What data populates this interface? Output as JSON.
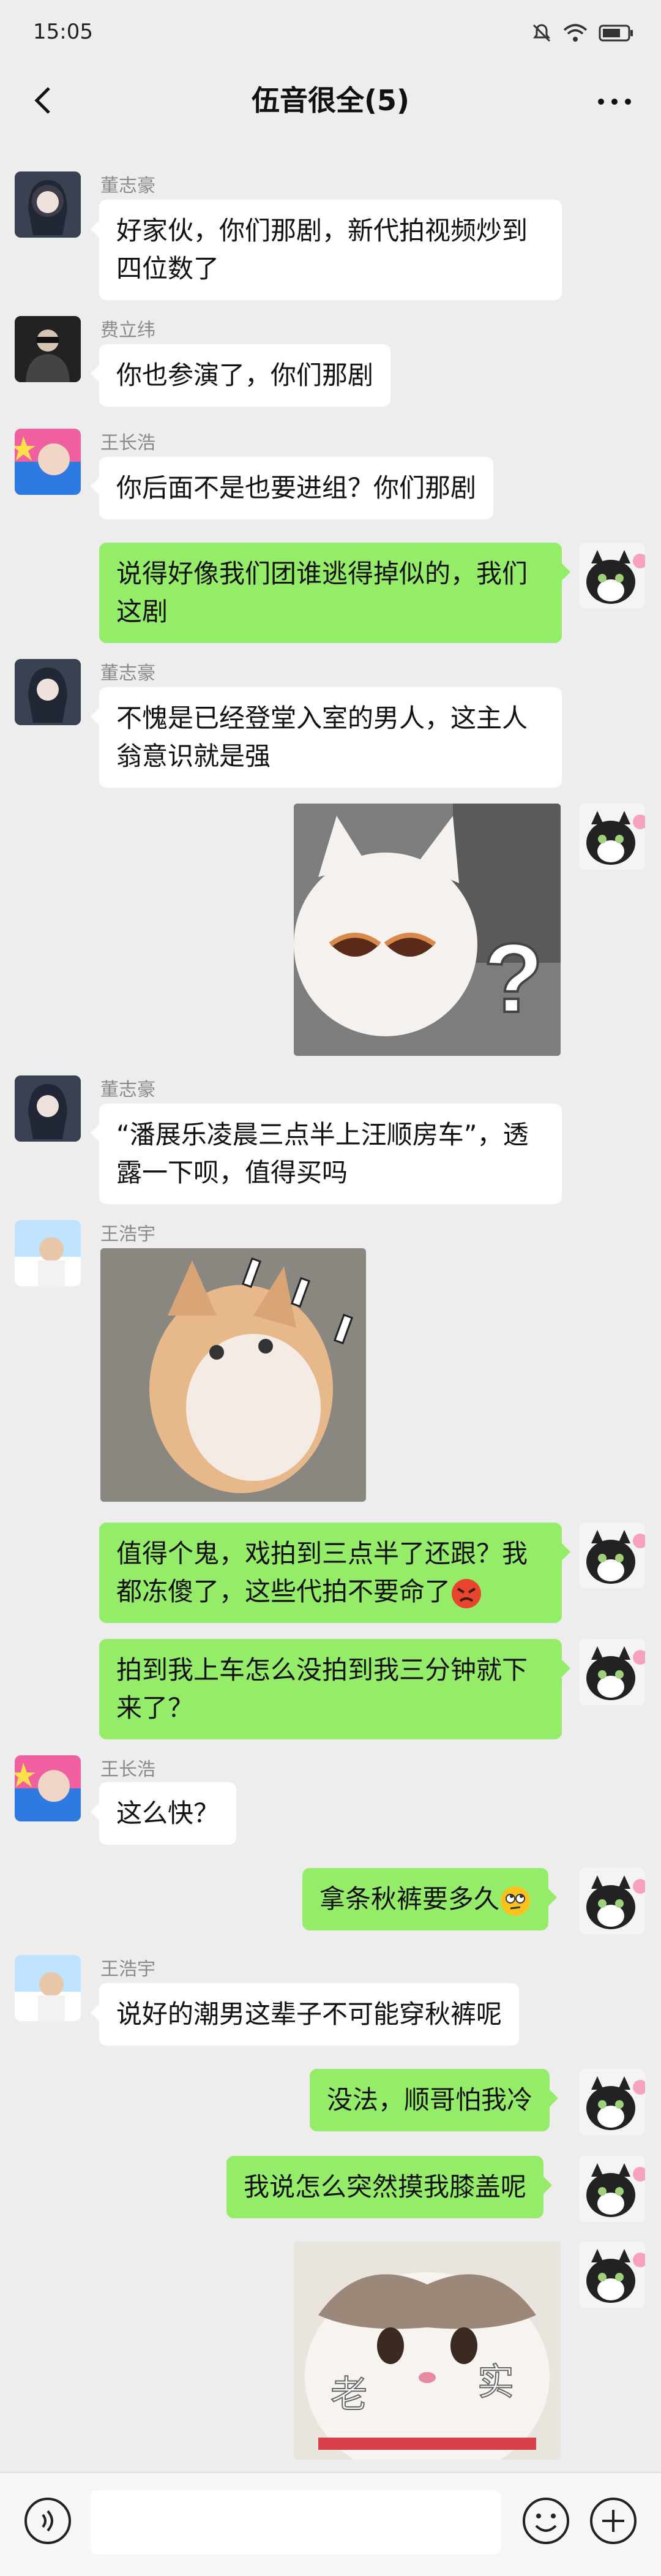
{
  "status": {
    "time": "15:05"
  },
  "header": {
    "title": "伍音很全(5)"
  },
  "messages": [
    {
      "sender": "董志豪",
      "text": "好家伙，你们那剧，新代拍视频炒到四位数了"
    },
    {
      "sender": "费立纬",
      "text": "你也参演了，你们那剧"
    },
    {
      "sender": "王长浩",
      "text": "你后面不是也要进组？你们那剧"
    },
    {
      "sender": "me",
      "text": "说得好像我们团谁逃得掉似的，我们这剧"
    },
    {
      "sender": "董志豪",
      "text": "不愧是已经登堂入室的男人，这主人翁意识就是强"
    },
    {
      "sender": "me",
      "sticker": "cat-sunglasses-question"
    },
    {
      "sender": "董志豪",
      "text": "“潘展乐凌晨三点半上汪顺房车”，透露一下呗，值得买吗"
    },
    {
      "sender": "王浩宇",
      "sticker": "kitten-shocked"
    },
    {
      "sender": "me",
      "text": "值得个鬼，戏拍到三点半了还跟？我都冻傻了，这些代拍不要命了",
      "emoji": "angry-face"
    },
    {
      "sender": "me",
      "text": "拍到我上车怎么没拍到我三分钟就下来了？"
    },
    {
      "sender": "王长浩",
      "text": "这么快？"
    },
    {
      "sender": "me",
      "text": "拿条秋裤要多久",
      "emoji": "eye-roll-face"
    },
    {
      "sender": "王浩宇",
      "text": "说好的潮男这辈子不可能穿秋裤呢"
    },
    {
      "sender": "me",
      "text": "没法，顺哥怕我冷"
    },
    {
      "sender": "me",
      "text": "我说怎么突然摸我膝盖呢"
    },
    {
      "sender": "me",
      "sticker": "cat-laoshi",
      "sticker_text_left": "老",
      "sticker_text_right": "实"
    }
  ],
  "sticker_text": {
    "question": "?",
    "exclaim": "!"
  },
  "icons": [
    "back-icon",
    "more-icon",
    "voice-icon",
    "emoji-icon",
    "plus-icon",
    "mute-icon",
    "wifi-icon",
    "battery-icon"
  ],
  "colors": {
    "background": "#ededed",
    "outgoing": "#95ec69",
    "incoming": "#ffffff"
  }
}
